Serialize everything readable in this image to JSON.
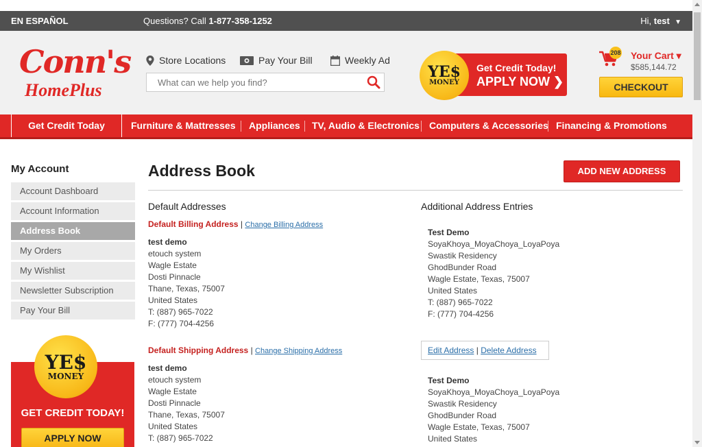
{
  "topbar": {
    "espanol": "EN ESPAÑOL",
    "questions_prefix": "Questions? Call ",
    "phone": "1-877-358-1252",
    "hi_prefix": "Hi, ",
    "user": "test",
    "caret": "▼"
  },
  "logo": {
    "line1": "Conn's",
    "line2": "HomePlus"
  },
  "header": {
    "store_locations": "Store Locations",
    "pay_bill": "Pay Your Bill",
    "weekly_ad": "Weekly Ad",
    "search_placeholder": "What can we help you find?"
  },
  "yes_banner": {
    "yes": "YE$",
    "money": "MONEY",
    "get_credit": "Get Credit Today!",
    "apply_now": "APPLY NOW ❯"
  },
  "cart": {
    "badge": "208",
    "label": "Your Cart ▾",
    "amount": "$585,144.72",
    "checkout": "CHECKOUT"
  },
  "nav": {
    "items": [
      "Get Credit Today",
      "Furniture & Mattresses",
      "Appliances",
      "TV, Audio & Electronics",
      "Computers & Accessories",
      "Financing & Promotions"
    ]
  },
  "sidebar": {
    "title": "My Account",
    "items": [
      "Account Dashboard",
      "Account Information",
      "Address Book",
      "My Orders",
      "My Wishlist",
      "Newsletter Subscription",
      "Pay Your Bill"
    ],
    "active_index": 2,
    "banner_yes": "YE$",
    "banner_money": "MONEY",
    "banner_title": "GET CREDIT TODAY!",
    "banner_button": "APPLY NOW"
  },
  "main": {
    "title": "Address Book",
    "add_button": "ADD NEW ADDRESS",
    "default_heading": "Default Addresses",
    "additional_heading": "Additional Address Entries",
    "billing": {
      "label": "Default Billing Address",
      "change": "Change Billing Address",
      "lines": [
        "test demo",
        "etouch system",
        "Wagle Estate",
        "Dosti Pinnacle",
        "Thane, Texas, 75007",
        "United States",
        "T: (887) 965-7022",
        "F: (777) 704-4256"
      ]
    },
    "shipping": {
      "label": "Default Shipping Address",
      "change": "Change Shipping Address",
      "lines": [
        "test demo",
        "etouch system",
        "Wagle Estate",
        "Dosti Pinnacle",
        "Thane, Texas, 75007",
        "United States",
        "T: (887) 965-7022"
      ]
    },
    "additional": [
      {
        "lines": [
          "Test Demo",
          "SoyaKhoya_MoyaChoya_LoyaPoya",
          "Swastik Residency",
          "GhodBunder Road",
          "Wagle Estate, Texas, 75007",
          "United States",
          "T: (887) 965-7022",
          "F: (777) 704-4256"
        ],
        "edit": "Edit Address",
        "delete": "Delete Address"
      },
      {
        "lines": [
          "Test Demo",
          "SoyaKhoya_MoyaChoya_LoyaPoya",
          "Swastik Residency",
          "GhodBunder Road",
          "Wagle Estate, Texas, 75007",
          "United States"
        ]
      }
    ]
  }
}
